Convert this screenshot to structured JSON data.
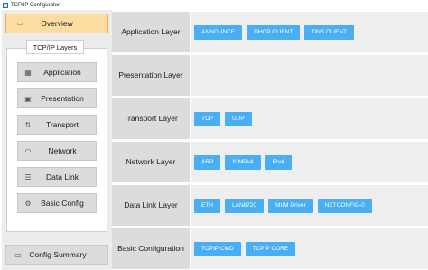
{
  "window": {
    "title": "TCP/IP Configurator"
  },
  "sidebar": {
    "overview_label": "Overview",
    "layers_header": "TCP/IP Layers",
    "items": [
      {
        "label": "Application",
        "icon": "grid-icon"
      },
      {
        "label": "Presentation",
        "icon": "image-icon"
      },
      {
        "label": "Transport",
        "icon": "sort-arrows-icon"
      },
      {
        "label": "Network",
        "icon": "wifi-icon"
      },
      {
        "label": "Data Link",
        "icon": "list-icon"
      },
      {
        "label": "Basic Config",
        "icon": "gear-icon"
      }
    ],
    "summary_label": "Config Summary"
  },
  "layers": [
    {
      "label": "Application Layer",
      "chips": [
        "ANNOUNCE",
        "DHCP CLIENT",
        "DNS CLIENT"
      ]
    },
    {
      "label": "Presentation Layer",
      "chips": []
    },
    {
      "label": "Transport Layer",
      "chips": [
        "TCP",
        "UDP"
      ]
    },
    {
      "label": "Network Layer",
      "chips": [
        "ARP",
        "ICMPv4",
        "IPv4"
      ]
    },
    {
      "label": "Data Link Layer",
      "chips": [
        "ETH",
        "LAN8720",
        "MIIM Driver",
        "NETCONFIG-0"
      ]
    },
    {
      "label": "Basic Configuration",
      "chips": [
        "TCPIP CMD",
        "TCPIP CORE"
      ]
    }
  ],
  "colors": {
    "accent": "#4aaef4",
    "overview_bg": "#fcdca0",
    "panel_bg": "#dcdcdc"
  }
}
